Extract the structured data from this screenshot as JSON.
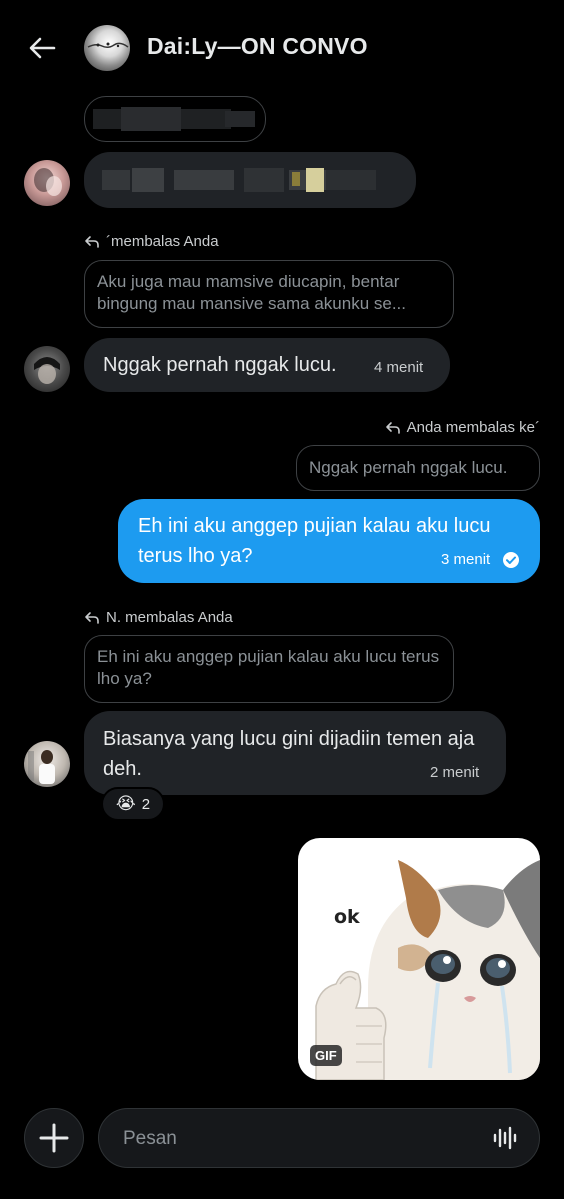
{
  "header": {
    "title": "Dai:Ly—ON CONVO"
  },
  "messages": {
    "m3": {
      "reply_label": "´membalas Anda",
      "quote": "Aku juga mau mamsive diucapin, bentar bingung mau mansive sama akunku se...",
      "text": "Nggak pernah nggak lucu.",
      "time": "4 menit"
    },
    "m4": {
      "reply_label": "Anda membalas ke´",
      "quote": "Nggak pernah nggak lucu.",
      "text": "Eh ini aku anggep pujian kalau aku lucu terus lho ya?",
      "time": "3 menit"
    },
    "m5": {
      "reply_label": "N. membalas Anda",
      "quote": "Eh ini aku anggep pujian kalau aku lucu terus lho ya?",
      "text": "Biasanya yang lucu gini dijadiin temen aja deh.",
      "time": "2 menit",
      "reaction_emoji": "😭",
      "reaction_count": "2"
    },
    "m6": {
      "gif_badge": "GIF",
      "sticker_text": "ok"
    }
  },
  "composer": {
    "placeholder": "Pesan"
  },
  "colors": {
    "background": "#000000",
    "incoming_bubble": "#202327",
    "outgoing_bubble": "#1d9bf0",
    "quote_border": "#3e4144"
  },
  "icons": {
    "back": "arrow-left-icon",
    "reply": "reply-arrow-icon",
    "sent": "check-circle-icon",
    "add": "plus-icon",
    "voice": "voice-wave-icon"
  }
}
